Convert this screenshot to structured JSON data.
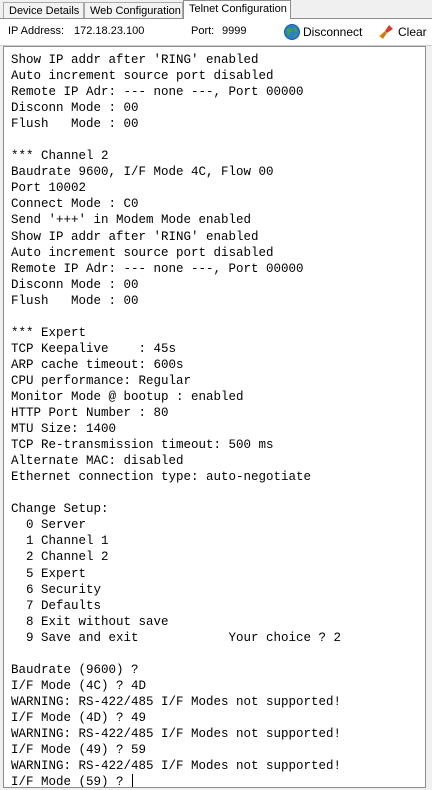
{
  "tabs": [
    {
      "label": "Device Details"
    },
    {
      "label": "Web Configuration"
    },
    {
      "label": "Telnet Configuration"
    }
  ],
  "toolbar": {
    "ip_label": "IP Address:",
    "ip_value": "172.18.23.100",
    "port_label": "Port:",
    "port_value": "9999",
    "disconnect_label": "Disconnect",
    "clear_label": "Clear"
  },
  "console": {
    "lines": [
      "Show IP addr after 'RING' enabled",
      "Auto increment source port disabled",
      "Remote IP Adr: --- none ---, Port 00000",
      "Disconn Mode : 00",
      "Flush   Mode : 00",
      "",
      "*** Channel 2",
      "Baudrate 9600, I/F Mode 4C, Flow 00",
      "Port 10002",
      "Connect Mode : C0",
      "Send '+++' in Modem Mode enabled",
      "Show IP addr after 'RING' enabled",
      "Auto increment source port disabled",
      "Remote IP Adr: --- none ---, Port 00000",
      "Disconn Mode : 00",
      "Flush   Mode : 00",
      "",
      "*** Expert",
      "TCP Keepalive    : 45s",
      "ARP cache timeout: 600s",
      "CPU performance: Regular",
      "Monitor Mode @ bootup : enabled",
      "HTTP Port Number : 80",
      "MTU Size: 1400",
      "TCP Re-transmission timeout: 500 ms",
      "Alternate MAC: disabled",
      "Ethernet connection type: auto-negotiate",
      "",
      "Change Setup:",
      "  0 Server",
      "  1 Channel 1",
      "  2 Channel 2",
      "  5 Expert",
      "  6 Security",
      "  7 Defaults",
      "  8 Exit without save",
      "  9 Save and exit            Your choice ? 2",
      "",
      "Baudrate (9600) ?",
      "I/F Mode (4C) ? 4D",
      "WARNING: RS-422/485 I/F Modes not supported!",
      "I/F Mode (4D) ? 49",
      "WARNING: RS-422/485 I/F Modes not supported!",
      "I/F Mode (49) ? 59",
      "WARNING: RS-422/485 I/F Modes not supported!",
      "I/F Mode (59) ? "
    ]
  },
  "colors": {
    "globe": "#2b7fc8",
    "broom": "#e07020",
    "border": "#8d8d8d"
  },
  "icons": {
    "disconnect": "globe-icon",
    "clear": "broom-icon"
  }
}
